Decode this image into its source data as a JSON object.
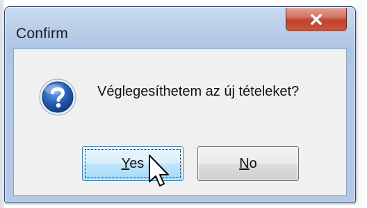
{
  "window": {
    "title": "Confirm"
  },
  "dialog": {
    "message": "Véglegesíthetem az új tételeket?",
    "icon": "question-icon"
  },
  "buttons": {
    "yes": {
      "accel": "Y",
      "rest": "es"
    },
    "no": {
      "accel": "N",
      "rest": "o"
    }
  },
  "icons": {
    "close": "close-icon",
    "question": "question-icon",
    "cursor": "mouse-pointer-icon"
  },
  "colors": {
    "close_button": "#c9543b",
    "question_icon": "#2a63b8",
    "focused_button": "#3c7fb1"
  }
}
